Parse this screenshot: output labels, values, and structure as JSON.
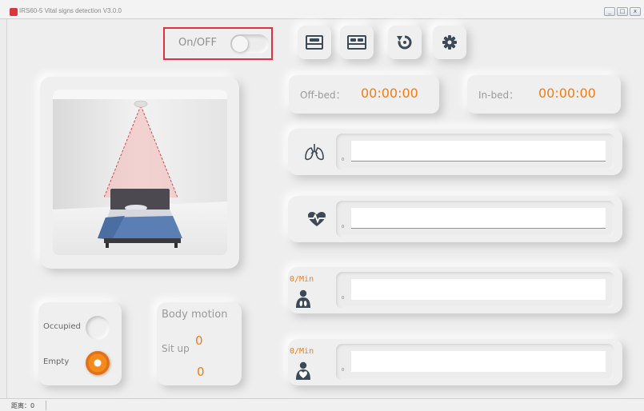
{
  "window": {
    "title": "IRS60-5 Vital signs detection V3.0.0",
    "buttons": [
      "_",
      "□",
      "x"
    ]
  },
  "toolbar": {
    "power_label": "On/OFF",
    "power_on": false,
    "buttons": [
      {
        "name": "single-bed-icon"
      },
      {
        "name": "double-bed-icon"
      },
      {
        "name": "refresh-icon"
      },
      {
        "name": "settings-gear-icon"
      }
    ]
  },
  "timers": {
    "off_bed_label": "Off-bed：",
    "off_bed_value": "00:00:00",
    "in_bed_label": "In-bed：",
    "in_bed_value": "00:00:00"
  },
  "graphs": {
    "zero_tick": "0",
    "respiration": {
      "icon": "lungs-icon"
    },
    "heart": {
      "icon": "heart-pulse-icon"
    },
    "rate1": {
      "label": "0/Min",
      "icon": "person-lungs-icon"
    },
    "rate2": {
      "label": "0/Min",
      "icon": "person-heart-icon"
    }
  },
  "occupancy": {
    "occupied_label": "Occupied",
    "empty_label": "Empty",
    "occupied_active": false,
    "empty_active": true
  },
  "motion": {
    "body_motion_label": "Body motion",
    "body_motion_value": "0",
    "sit_up_label": "Sit up",
    "sit_up_value": "0"
  },
  "status": {
    "text": "距离：0"
  },
  "colors": {
    "accent": "#f07d14",
    "highlight_border": "#e0323a",
    "icon": "#3c4a57"
  }
}
